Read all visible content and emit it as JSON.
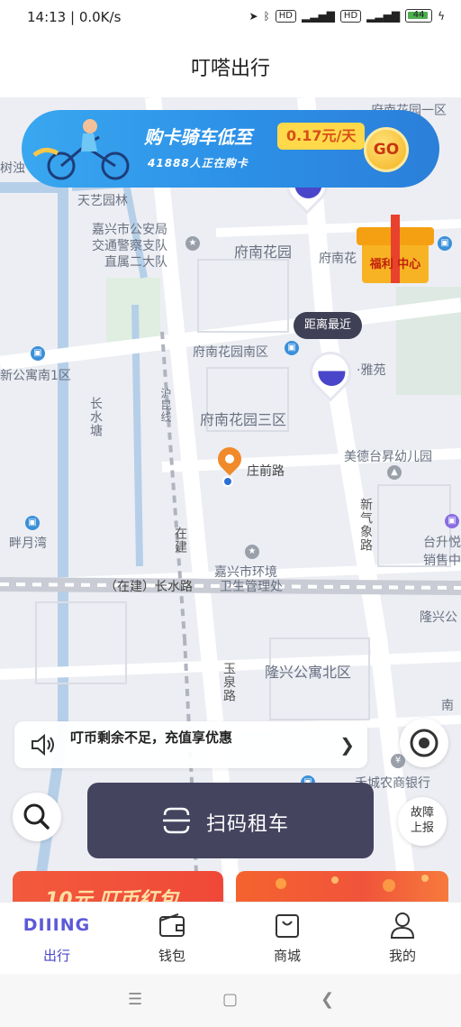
{
  "status_bar": {
    "time": "14:13",
    "speed": "0.0K/s",
    "battery": "44"
  },
  "app": {
    "title": "叮嗒出行"
  },
  "banner": {
    "headline": "购卡骑车低至",
    "price": "0.17元/天",
    "subline": "41888人正在购卡",
    "go_label": "GO"
  },
  "gift": {
    "label": "福利 中心"
  },
  "map": {
    "nearest_tag": "距离最近",
    "labels": {
      "shuzhu": "树浊",
      "tianyi": "天艺园林",
      "police1": "嘉兴市公安局",
      "police2": "交通警察支队",
      "police3": "直属二大队",
      "fnhy": "府南花园",
      "fnhy_r": "府南花",
      "fnhy_nq": "府南花园南区",
      "fnhy_1": "府南花园一区",
      "yayuan": "·雅苑",
      "xgy": "新公寓南1区",
      "cslu": "长水塘",
      "hklx": "沪昆线",
      "fnhy_3": "府南花园三区",
      "zqlu": "庄前路",
      "mdtyey": "美德台昇幼儿园",
      "xqxlu": "新气象路",
      "pyw": "畔月湾",
      "zaijian": "在建",
      "tsxs": "台升悦销售中",
      "jxhj1": "嘉兴市环境",
      "jxhj2": "卫生管理处",
      "cslu2": "（在建）长水路",
      "lxg": "隆兴公",
      "ylu": "玉泉路",
      "lxgybq": "隆兴公寓北区",
      "nan": "南",
      "mbank": "禾城农商银行",
      "qianlu": "庄前路"
    }
  },
  "notice": {
    "text": "叮币剩余不足，充值享优惠"
  },
  "report_button": {
    "line1": "故障",
    "line2": "上报"
  },
  "scan_button": {
    "label": "扫码租车"
  },
  "promo": {
    "left": "10元 叮币红包"
  },
  "tabs": [
    {
      "label": "出行",
      "icon": "diiing-logo",
      "logo_text": "DIIING"
    },
    {
      "label": "钱包",
      "icon": "wallet-icon"
    },
    {
      "label": "商城",
      "icon": "shop-bag-icon"
    },
    {
      "label": "我的",
      "icon": "person-icon"
    }
  ],
  "colors": {
    "accent": "#4a46c9",
    "scan_button": "#45445f",
    "banner": "#2c8fe6",
    "promo": "#f04838"
  }
}
